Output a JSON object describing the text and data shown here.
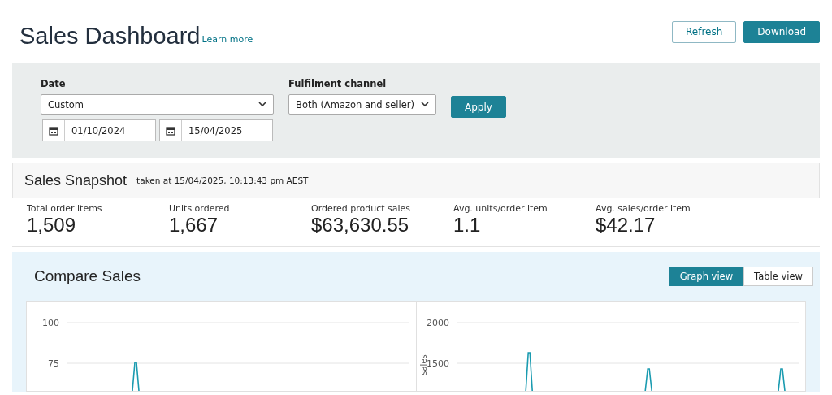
{
  "header": {
    "title": "Sales Dashboard",
    "learn_more": "Learn more",
    "buttons": [
      {
        "label": "Refresh",
        "kind": "secondary"
      },
      {
        "label": "Download",
        "kind": "primary"
      }
    ]
  },
  "filters": {
    "date": {
      "label": "Date",
      "value": "Custom",
      "start": "01/10/2024",
      "end": "15/04/2025"
    },
    "channel": {
      "label": "Fulfilment channel",
      "value": "Both (Amazon and seller)"
    },
    "apply": "Apply"
  },
  "snapshot": {
    "title": "Sales Snapshot",
    "taken": "taken at 15/04/2025, 10:13:43 pm AEST",
    "metrics": [
      {
        "label": "Total order items",
        "value": "1,509"
      },
      {
        "label": "Units ordered",
        "value": "1,667"
      },
      {
        "label": "Ordered product sales",
        "value": "$63,630.55"
      },
      {
        "label": "Avg. units/order item",
        "value": "1.1"
      },
      {
        "label": "Avg. sales/order item",
        "value": "$42.17"
      }
    ]
  },
  "compare": {
    "title": "Compare Sales",
    "views": [
      {
        "label": "Graph view",
        "selected": true
      },
      {
        "label": "Table view",
        "selected": false
      }
    ],
    "charts": [
      {
        "y_ticks": [
          "100",
          "75"
        ]
      },
      {
        "ylabel": "sales",
        "y_ticks": [
          "2000",
          "1500"
        ]
      }
    ]
  }
}
